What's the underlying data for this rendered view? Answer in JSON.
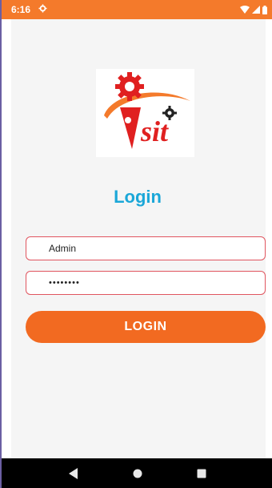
{
  "status_bar": {
    "time": "6:16",
    "icons": [
      "settings-gear-icon",
      "wifi-icon",
      "signal-icon",
      "battery-icon"
    ],
    "background_color": "#f47a2b"
  },
  "logo": {
    "text": "sit",
    "colors": {
      "orange": "#f26a21",
      "red": "#e02020",
      "swoosh": "#f47a2b"
    }
  },
  "login": {
    "title": "Login",
    "title_color": "#1ba7d8",
    "username_value": "Admin",
    "password_value": "••••••••",
    "button_label": "LOGIN",
    "button_color": "#f26a21",
    "field_border_color": "#e0555f"
  },
  "nav_bar": {
    "buttons": [
      "back-icon",
      "home-icon",
      "recents-icon"
    ]
  }
}
